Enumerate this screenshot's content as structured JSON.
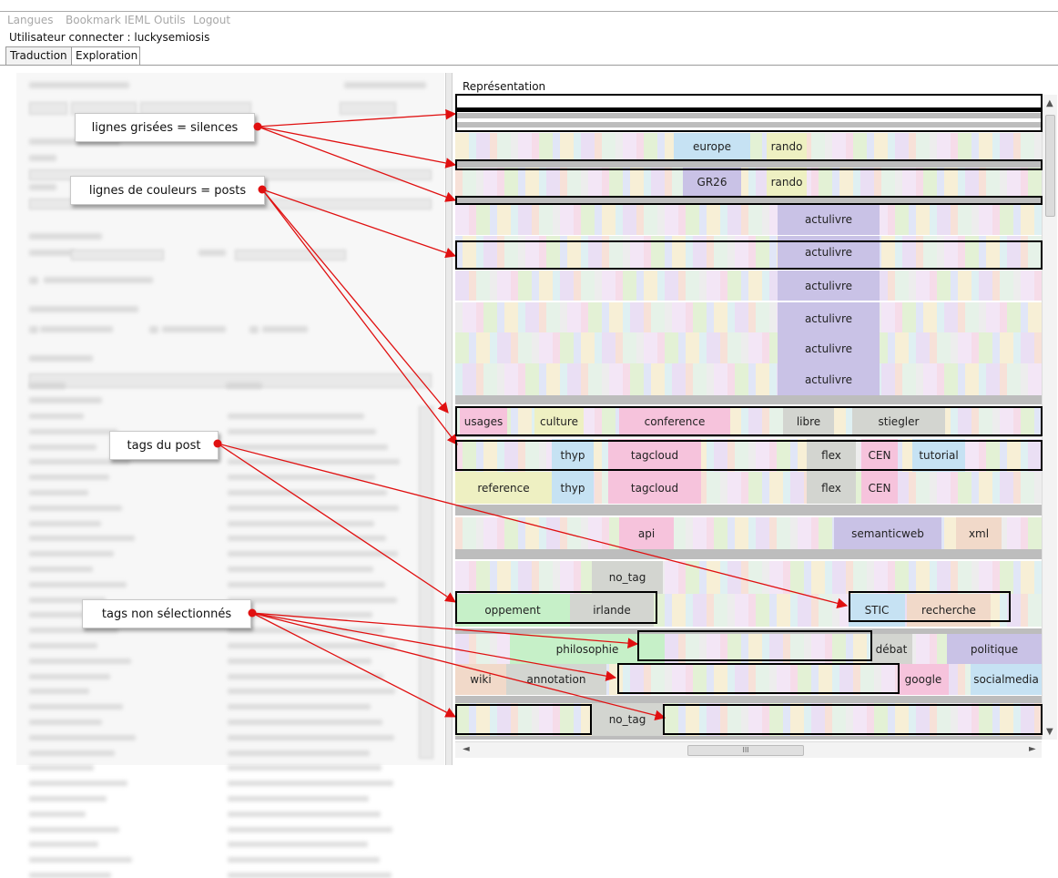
{
  "menu": {
    "items": [
      "Langues",
      "Bookmark IEML",
      "Outils",
      "Logout"
    ]
  },
  "user_line": "Utilisateur connecter : luckysemiosis",
  "tabs": [
    {
      "label": "Traduction"
    },
    {
      "label": "Exploration"
    }
  ],
  "right_panel": {
    "title": "Représentation"
  },
  "rows": [
    {
      "tags": []
    },
    {
      "tags": [
        "europe",
        "rando"
      ]
    },
    {
      "tags": [
        "GR26",
        "rando"
      ]
    },
    {
      "tags": [
        "actulivre"
      ]
    },
    {
      "tags": [
        "actulivre"
      ]
    },
    {
      "tags": [
        "actulivre"
      ]
    },
    {
      "tags": [
        "actulivre"
      ]
    },
    {
      "tags": [
        "actulivre"
      ]
    },
    {
      "tags": [
        "actulivre"
      ]
    },
    {
      "tags": [
        "usages",
        "culture",
        "conference",
        "libre",
        "stiegler"
      ]
    },
    {
      "tags": [
        "thyp",
        "tagcloud",
        "flex",
        "CEN",
        "tutorial"
      ]
    },
    {
      "tags": [
        "reference",
        "thyp",
        "tagcloud",
        "flex",
        "CEN"
      ]
    },
    {
      "tags": [
        "api",
        "semanticweb",
        "xml"
      ]
    },
    {
      "tags": [
        "no_tag"
      ]
    },
    {
      "tags": [
        "oppement",
        "irlande",
        "STIC",
        "recherche"
      ]
    },
    {
      "tags": [
        "philosophie",
        "débat",
        "politique"
      ]
    },
    {
      "tags": [
        "wiki",
        "annotation",
        "google",
        "socialmedia"
      ]
    },
    {
      "tags": [
        "no_tag"
      ]
    }
  ],
  "callouts": {
    "silences": "lignes grisées = silences",
    "posts": "lignes de couleurs = posts",
    "tags_post": "tags du post",
    "tags_non": "tags non sélectionnés"
  },
  "colors": {
    "arrow": "#e01010",
    "box": "#000000",
    "tag_pink": "#f6c3dc",
    "tag_yellow": "#eef0c2",
    "tag_purple": "#c9c2e6",
    "tag_blue": "#c6e2f3",
    "tag_green": "#c6f0c8",
    "tag_gray": "#d3d5d0"
  },
  "scrollbar": {
    "h_thumb": "III"
  }
}
